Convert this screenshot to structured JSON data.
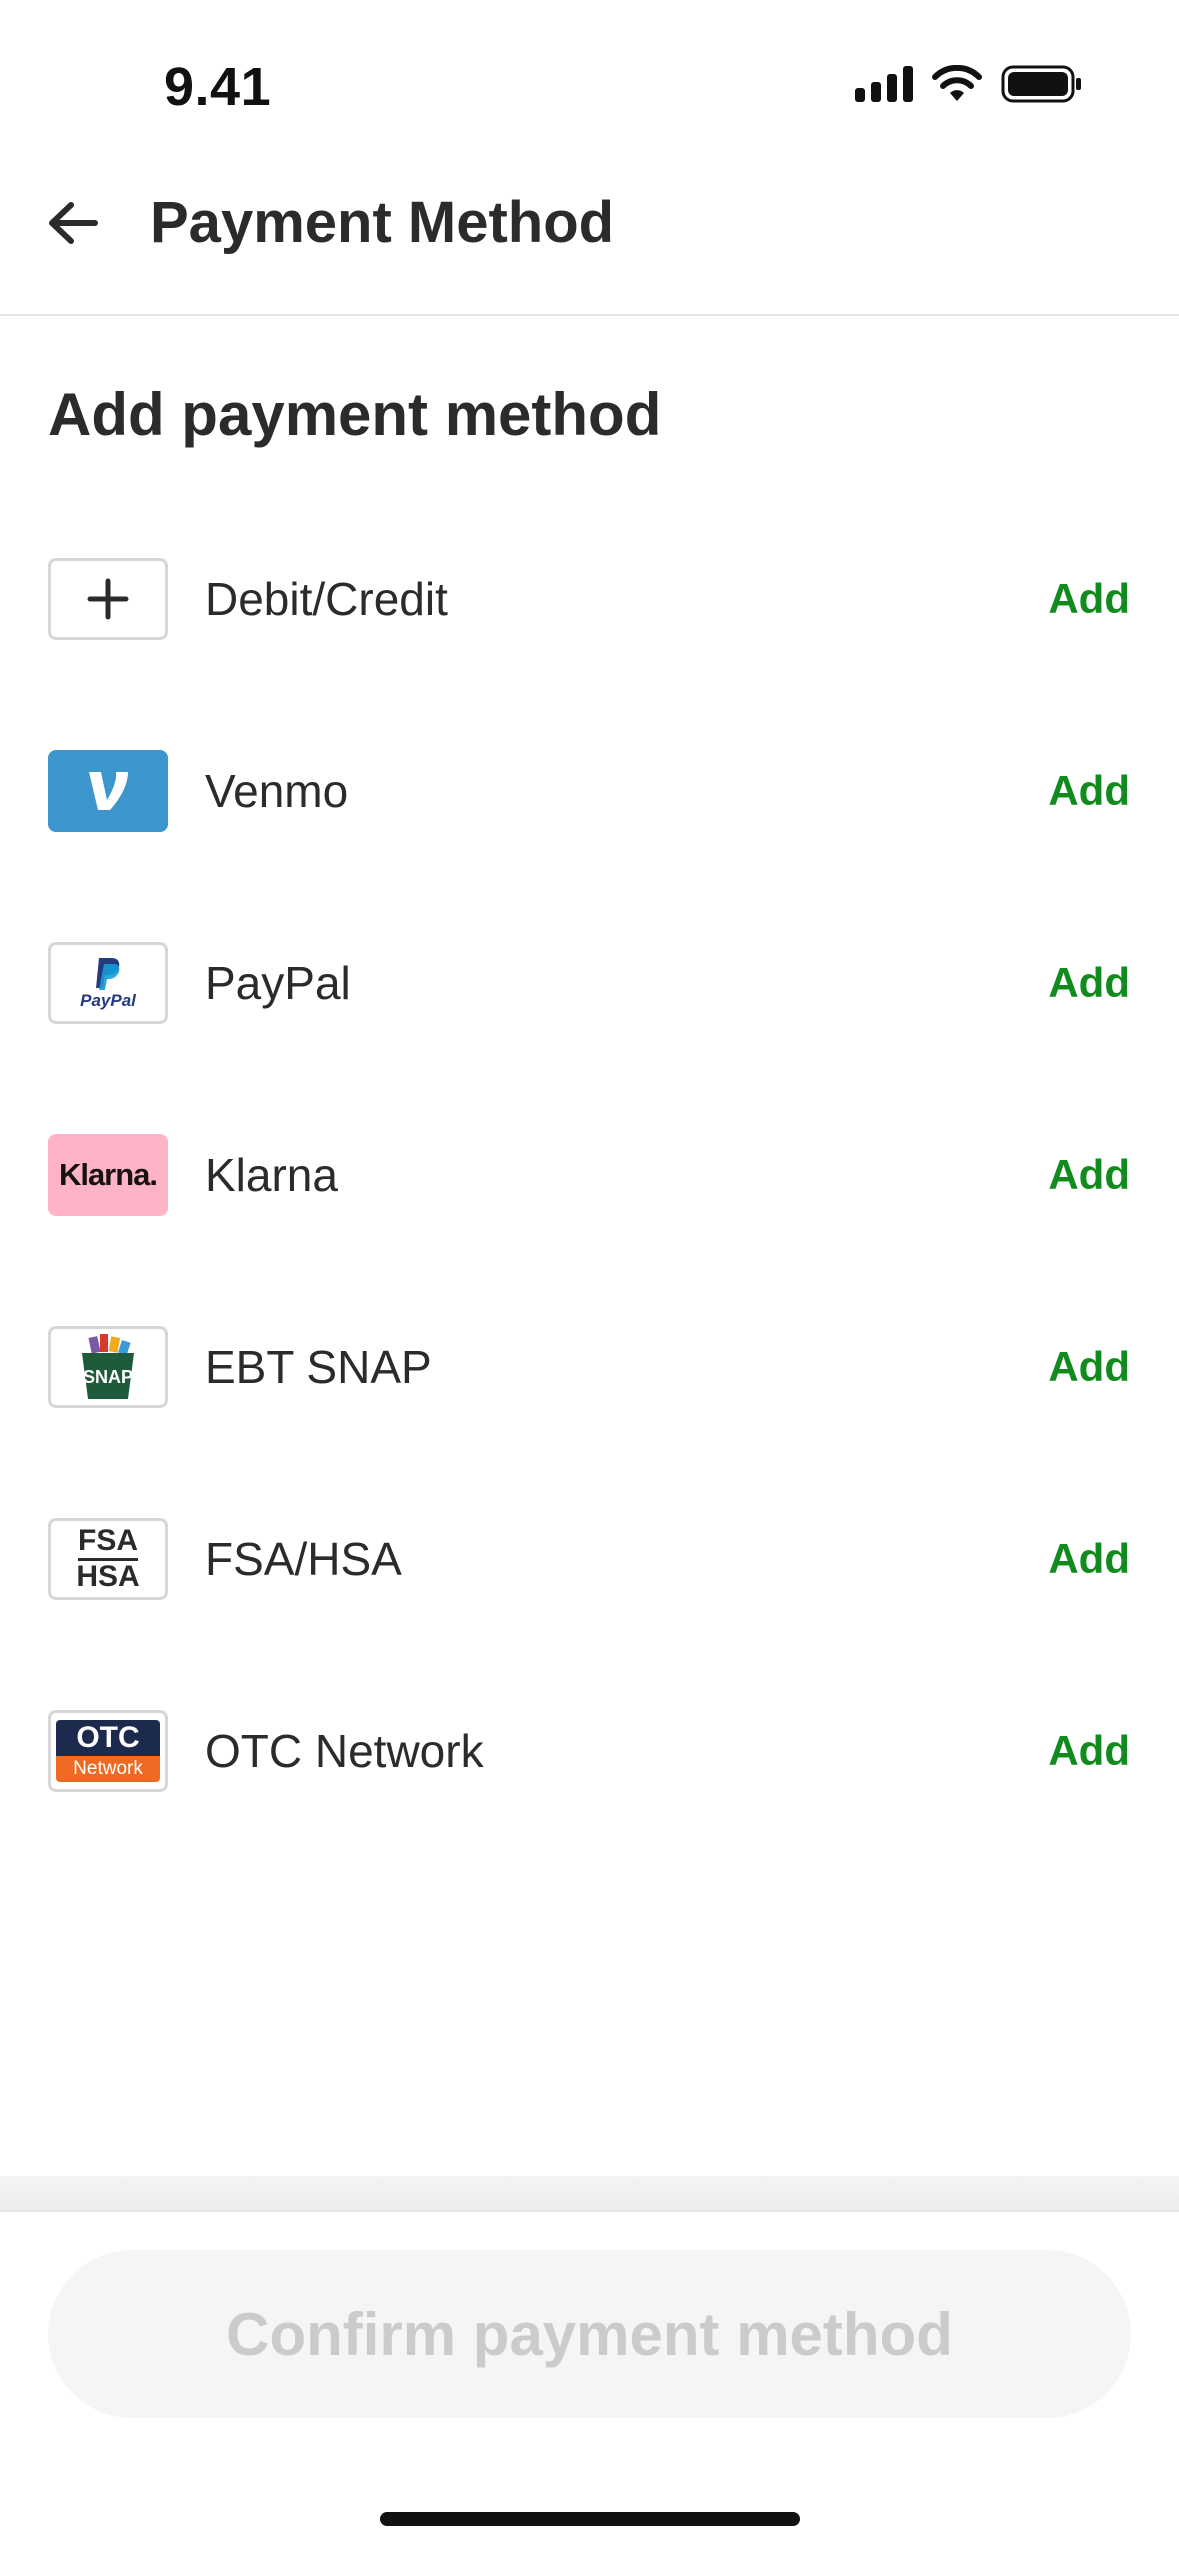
{
  "status": {
    "time": "9.41"
  },
  "header": {
    "title": "Payment Method"
  },
  "section_title": "Add payment method",
  "methods": [
    {
      "label": "Debit/Credit",
      "action": "Add",
      "icon": "plus-icon"
    },
    {
      "label": "Venmo",
      "action": "Add",
      "icon": "venmo-logo"
    },
    {
      "label": "PayPal",
      "action": "Add",
      "icon": "paypal-logo",
      "logo_text": "PayPal"
    },
    {
      "label": "Klarna",
      "action": "Add",
      "icon": "klarna-logo",
      "logo_text": "Klarna."
    },
    {
      "label": "EBT SNAP",
      "action": "Add",
      "icon": "ebt-snap-logo",
      "logo_text": "SNAP"
    },
    {
      "label": "FSA/HSA",
      "action": "Add",
      "icon": "fsa-hsa-logo",
      "logo_top": "FSA",
      "logo_bottom": "HSA"
    },
    {
      "label": "OTC Network",
      "action": "Add",
      "icon": "otc-network-logo",
      "logo_top": "OTC",
      "logo_bottom": "Network"
    }
  ],
  "confirm_button": {
    "label": "Confirm payment method",
    "enabled": false
  },
  "colors": {
    "accent_green": "#118a1e",
    "venmo_blue": "#3d95ce",
    "klarna_pink": "#ffb3c7",
    "otc_navy": "#1c2b4d",
    "otc_orange": "#ee6a22",
    "disabled_text": "#c9cbcd"
  }
}
